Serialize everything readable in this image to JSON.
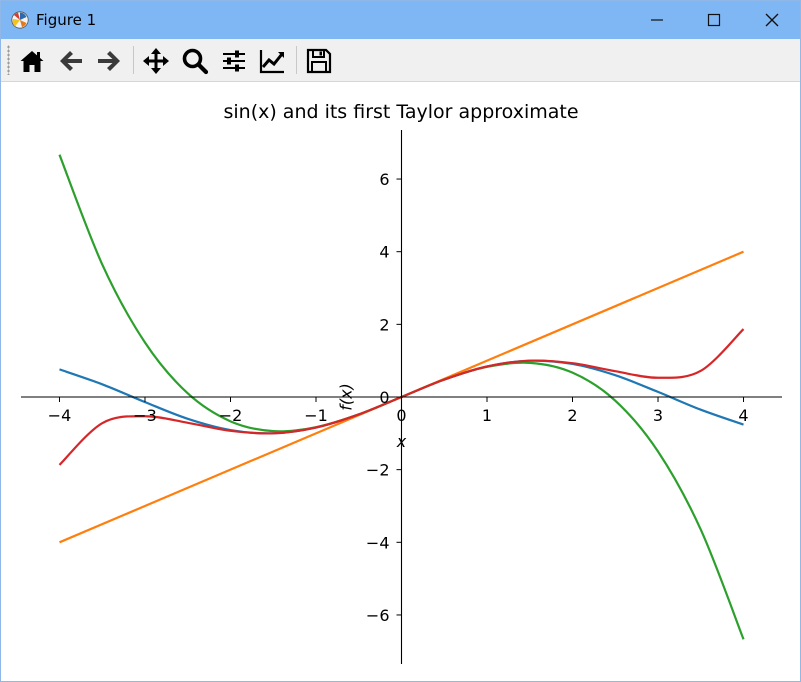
{
  "window": {
    "title": "Figure 1",
    "controls": {
      "minimize": "minimize",
      "maximize": "maximize",
      "close": "close"
    }
  },
  "toolbar": {
    "tools": [
      {
        "id": "home",
        "icon": "home-icon"
      },
      {
        "id": "back",
        "icon": "arrow-left-icon"
      },
      {
        "id": "forward",
        "icon": "arrow-right-icon"
      },
      {
        "id": "pan",
        "icon": "move-icon"
      },
      {
        "id": "zoom",
        "icon": "magnifier-icon"
      },
      {
        "id": "subplots",
        "icon": "sliders-icon"
      },
      {
        "id": "edit-axes",
        "icon": "chart-line-icon"
      },
      {
        "id": "save",
        "icon": "floppy-disk-icon"
      }
    ]
  },
  "chart_data": {
    "type": "line",
    "title": "sin(x) and its first Taylor approximate",
    "xlabel": "x",
    "ylabel": "f(x)",
    "xlim": [
      -4.45,
      4.45
    ],
    "ylim": [
      -7.35,
      7.35
    ],
    "xticks": [
      -4,
      -3,
      -2,
      -1,
      0,
      1,
      2,
      3,
      4
    ],
    "xtick_labels": [
      "−4",
      "−3",
      "−2",
      "−1",
      "0",
      "1",
      "2",
      "3",
      "4"
    ],
    "yticks": [
      -6,
      -4,
      -2,
      0,
      2,
      4,
      6
    ],
    "ytick_labels": [
      "−6",
      "−4",
      "−2",
      "0",
      "2",
      "4",
      "6"
    ],
    "axes_through_origin": true,
    "grid": false,
    "series": [
      {
        "color": "#1f77b4",
        "x": [
          -4,
          -3.5,
          -3,
          -2.5,
          -2,
          -1.5,
          -1,
          -0.5,
          0,
          0.5,
          1,
          1.5,
          2,
          2.5,
          3,
          3.5,
          4
        ],
        "y": [
          0.76,
          0.35,
          -0.14,
          -0.6,
          -0.91,
          -1.0,
          -0.84,
          -0.48,
          0,
          0.48,
          0.84,
          1.0,
          0.91,
          0.6,
          0.14,
          -0.35,
          -0.76
        ]
      },
      {
        "color": "#ff7f0e",
        "x": [
          -4,
          4
        ],
        "y": [
          -4,
          4
        ]
      },
      {
        "color": "#2ca02c",
        "x": [
          -4,
          -3.5,
          -3,
          -2.5,
          -2,
          -1.5,
          -1,
          -0.5,
          0,
          0.5,
          1,
          1.5,
          2,
          2.5,
          3,
          3.5,
          4
        ],
        "y": [
          6.67,
          3.65,
          1.5,
          0.1,
          -0.67,
          -0.94,
          -0.83,
          -0.48,
          0,
          0.48,
          0.83,
          0.94,
          0.67,
          -0.1,
          -1.5,
          -3.65,
          -6.67
        ]
      },
      {
        "color": "#d62728",
        "x": [
          -4,
          -3.5,
          -3,
          -2.5,
          -2,
          -1.5,
          -1,
          -0.5,
          0,
          0.5,
          1,
          1.5,
          2,
          2.5,
          3,
          3.5,
          4
        ],
        "y": [
          -1.87,
          -0.72,
          -0.53,
          -0.71,
          -0.93,
          -1.0,
          -0.84,
          -0.48,
          0,
          0.48,
          0.84,
          1.0,
          0.93,
          0.71,
          0.53,
          0.72,
          1.87
        ]
      }
    ]
  }
}
